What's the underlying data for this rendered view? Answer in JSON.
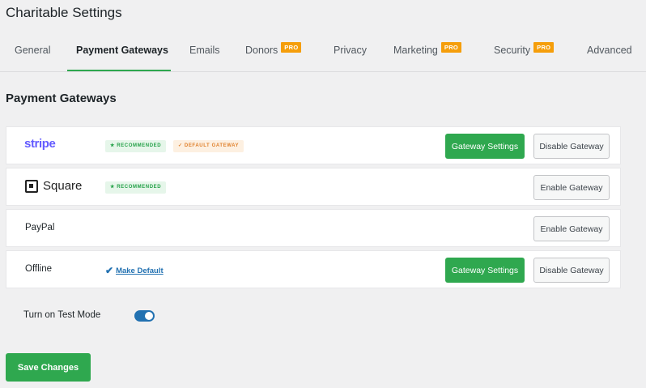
{
  "page": {
    "title": "Charitable Settings"
  },
  "tabs": [
    {
      "label": "General",
      "pro": ""
    },
    {
      "label": "Payment Gateways",
      "pro": "",
      "active": true
    },
    {
      "label": "Emails",
      "pro": ""
    },
    {
      "label": "Donors",
      "pro": "PRO"
    },
    {
      "label": "Privacy",
      "pro": ""
    },
    {
      "label": "Marketing",
      "pro": "PRO"
    },
    {
      "label": "Security",
      "pro": "PRO"
    },
    {
      "label": "Advanced",
      "pro": ""
    }
  ],
  "section": {
    "title": "Payment Gateways"
  },
  "gateways": [
    {
      "name": "stripe",
      "badges": [
        "★ RECOMMENDED",
        "✓ DEFAULT GATEWAY"
      ],
      "settings_label": "Gateway Settings",
      "action_label": "Disable Gateway"
    },
    {
      "name": "Square",
      "badges": [
        "★ RECOMMENDED"
      ],
      "action_label": "Enable Gateway"
    },
    {
      "name": "PayPal",
      "action_label": "Enable Gateway"
    },
    {
      "name": "Offline",
      "make_default": "Make Default",
      "settings_label": "Gateway Settings",
      "action_label": "Disable Gateway"
    }
  ],
  "test_mode": {
    "label": "Turn on Test Mode",
    "enabled": true
  },
  "save": {
    "label": "Save Changes"
  },
  "colors": {
    "accent": "#2fa84f",
    "pro_badge": "#f59e0b",
    "stripe_brand": "#635bff",
    "toggle_on": "#2271b1"
  }
}
